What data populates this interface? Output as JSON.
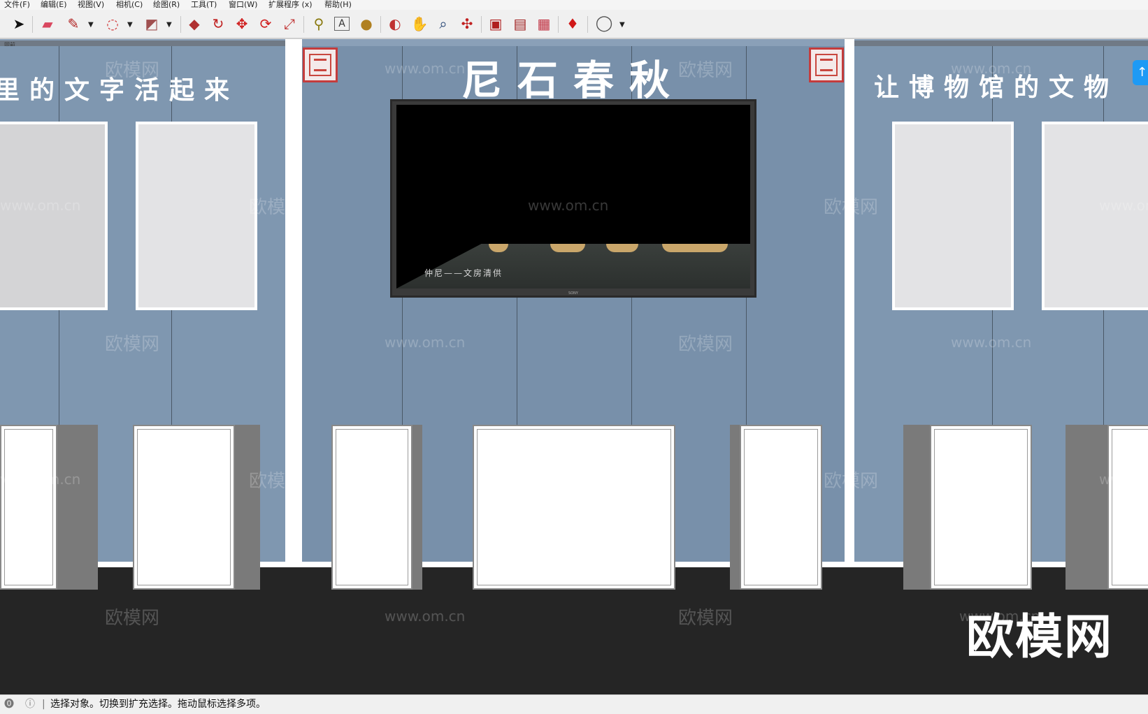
{
  "menu": [
    "文件(F)",
    "编辑(E)",
    "视图(V)",
    "相机(C)",
    "绘图(R)",
    "工具(T)",
    "窗口(W)",
    "扩展程序 (x)",
    "帮助(H)"
  ],
  "toolbar": {
    "select": "➤",
    "eraser": "▰",
    "pencil": "✎",
    "arc": "◌",
    "shape": "◩",
    "push_pull": "◆",
    "follow_me": "↻",
    "move": "✥",
    "rotate": "⟳",
    "scale": "⤢",
    "tape": "⚲",
    "text": "A",
    "paint": "●",
    "orbit": "◐",
    "pan": "✋",
    "zoom": "⌕",
    "zoom_extents": "✣",
    "warehouse": "▣",
    "extension_warehouse": "▤",
    "layout": "▦",
    "ruby": "♦",
    "account": "◯",
    "dropdown": "▼"
  },
  "scene": {
    "label": "同前",
    "center_title": "尼石春秋",
    "left_title": "里的文字活起来",
    "right_title": "让博物馆的文物",
    "tv_subtitle": "仲尼——文房清供",
    "tv_brand": "SONY",
    "watermarks": [
      "欧模网",
      "www.om.cn"
    ],
    "logo": "欧模网",
    "up_arrow": "↑"
  },
  "status": {
    "icon1": "⓿",
    "icon2": "ⓘ",
    "divider": "|",
    "message": "选择对象。切换到扩充选择。拖动鼠标选择多项。"
  },
  "colors": {
    "wall": "#7f97b0",
    "floor": "#252525",
    "seal": "#c43c3c",
    "accent": "#1e9af5"
  }
}
